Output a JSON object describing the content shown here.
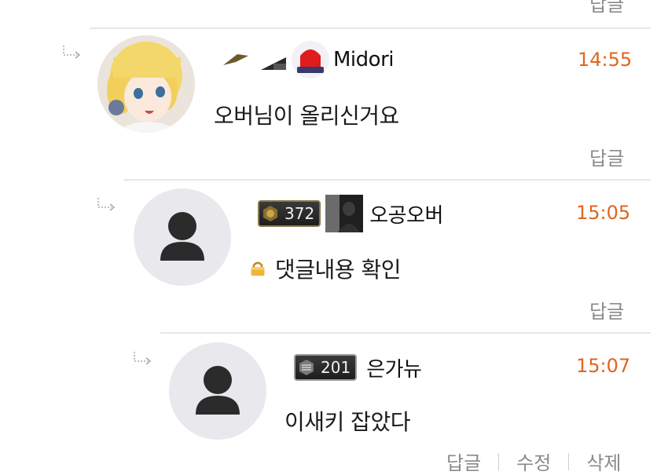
{
  "top": {
    "reply_label": "답글"
  },
  "comments": [
    {
      "nickname": "Midori",
      "time": "14:55",
      "text": "오버님이 올리신거요",
      "reply_label": "답글"
    },
    {
      "level": "372",
      "nickname": "오공오버",
      "time": "15:05",
      "text": "댓글내용 확인",
      "reply_label": "답글",
      "locked": true
    },
    {
      "level": "201",
      "nickname": "은가뉴",
      "time": "15:07",
      "text": "이새키 잡았다",
      "actions": {
        "reply": "답글",
        "edit": "수정",
        "delete": "삭제"
      }
    }
  ],
  "colors": {
    "time": "#e0651f",
    "muted": "#8a8a8a",
    "divider": "#e6e6e6",
    "avatar_bg": "#e9e8ec"
  },
  "icons": [
    "reply-arrow-icon",
    "default-avatar-icon",
    "lock-icon",
    "level-badge-icon",
    "siren-icon"
  ]
}
